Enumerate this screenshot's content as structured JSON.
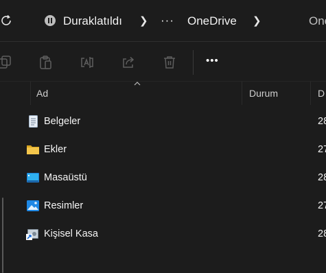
{
  "addressbar": {
    "status_label": "Duraklatıldı",
    "more_label": "···",
    "location_label": "OneDrive",
    "search_placeholder_partial": "One"
  },
  "toolbar": {
    "icons": [
      "copy-icon",
      "paste-icon",
      "rename-icon",
      "share-icon",
      "delete-icon"
    ],
    "more_label": "•••"
  },
  "columns": {
    "name": "Ad",
    "status": "Durum",
    "date_partial": "D"
  },
  "rows": [
    {
      "name": "Belgeler",
      "date_partial": "28",
      "icon": "documents-folder-icon"
    },
    {
      "name": "Ekler",
      "date_partial": "27",
      "icon": "folder-icon"
    },
    {
      "name": "Masaüstü",
      "date_partial": "28",
      "icon": "desktop-folder-icon"
    },
    {
      "name": "Resimler",
      "date_partial": "27",
      "icon": "pictures-folder-icon"
    },
    {
      "name": "Kişisel Kasa",
      "date_partial": "28",
      "icon": "personal-vault-shortcut-icon"
    }
  ],
  "colors": {
    "background": "#1c1c1c",
    "folder_yellow": "#f4c64b",
    "accent_blue": "#2a9be8"
  }
}
